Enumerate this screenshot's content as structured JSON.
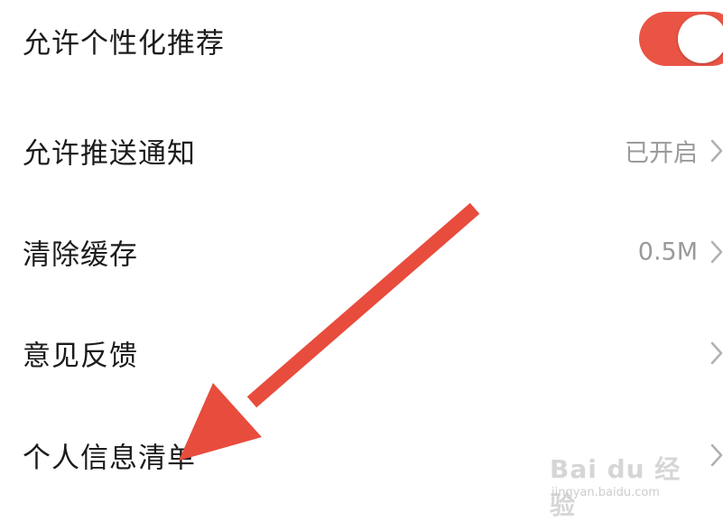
{
  "settings": {
    "items": [
      {
        "label": "允许个性化推荐",
        "type": "toggle",
        "enabled": true
      },
      {
        "label": "允许推送通知",
        "value": "已开启"
      },
      {
        "label": "清除缓存",
        "value": "0.5M"
      },
      {
        "label": "意见反馈",
        "value": ""
      },
      {
        "label": "个人信息清单",
        "value": ""
      }
    ]
  },
  "colors": {
    "toggle_on": "#ea5445",
    "annotation_arrow": "#e84c3d",
    "label_text": "#1b1b1b",
    "value_text": "#9a9a9a",
    "chevron": "#b0b0b0"
  },
  "annotation": {
    "type": "arrow",
    "points_to": "个人信息清单"
  },
  "watermark": {
    "logo": "Bai du 经验",
    "url": "jingyan.baidu.com"
  }
}
